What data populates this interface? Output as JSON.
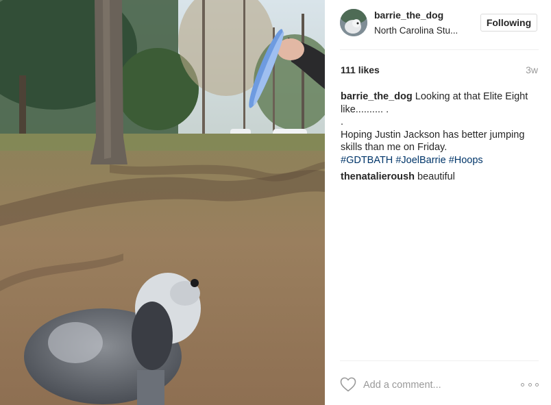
{
  "post": {
    "username": "barrie_the_dog",
    "location": "North Carolina Stu...",
    "follow_label": "Following",
    "likes": "111 likes",
    "time_ago": "3w",
    "caption": {
      "author": "barrie_the_dog",
      "line1": "Looking at that Elite Eight like.......... .",
      "line2": ".",
      "line3": "Hoping Justin Jackson has better jumping skills than me on Friday.",
      "hashtags": [
        "#GDTBATH",
        "#JoelBarrie",
        "#Hoops"
      ]
    },
    "comments": [
      {
        "author": "thenatalieroush",
        "text": "beautiful"
      }
    ],
    "add_comment_placeholder": "Add a comment...",
    "icons": {
      "like": "heart-outline-icon",
      "more": "more-options-icon"
    }
  },
  "colors": {
    "text": "#262626",
    "muted": "#999999",
    "hashtag": "#003569",
    "border": "#dbdbdb"
  }
}
